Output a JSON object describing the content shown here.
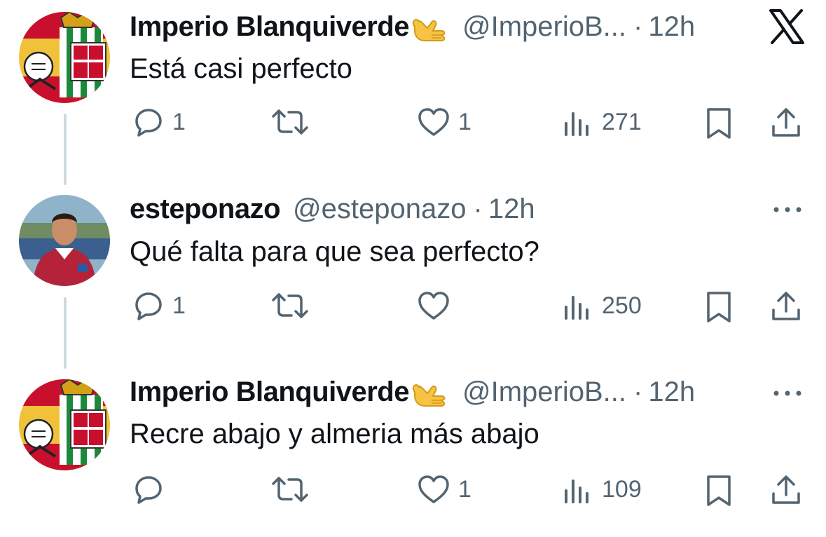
{
  "tweets": [
    {
      "name": "Imperio Blanquiverde",
      "handle": "@ImperioB...",
      "separator": "·",
      "time": "12h",
      "text": "Está casi perfecto",
      "replies": "1",
      "retweets": "",
      "likes": "1",
      "views": "271",
      "corner_icon": "x-logo-icon"
    },
    {
      "name": "esteponazo",
      "handle": "@esteponazo",
      "separator": "·",
      "time": "12h",
      "text": "Qué falta para que sea perfecto?",
      "replies": "1",
      "retweets": "",
      "likes": "",
      "views": "250",
      "corner_icon": "more-icon"
    },
    {
      "name": "Imperio Blanquiverde",
      "handle": "@ImperioB...",
      "separator": "·",
      "time": "12h",
      "text": "Recre abajo y almeria más abajo",
      "replies": "",
      "retweets": "",
      "likes": "1",
      "views": "109",
      "corner_icon": "more-icon"
    }
  ],
  "icons": {
    "reply": "reply-icon",
    "retweet": "retweet-icon",
    "like": "like-icon",
    "views": "views-icon",
    "bookmark": "bookmark-icon",
    "share": "share-icon",
    "emoji": "call-me-hand-emoji-icon"
  },
  "colors": {
    "text": "#0f1419",
    "secondary": "#536471",
    "thread_line": "#cfd9de"
  }
}
